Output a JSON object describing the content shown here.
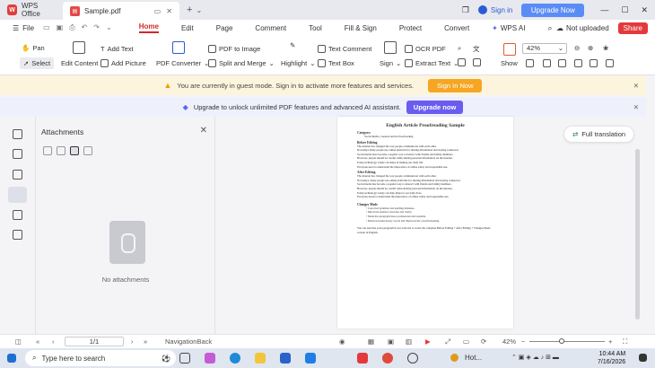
{
  "titlebar": {
    "app_tab": "WPS Office",
    "doc_tab": "Sample.pdf",
    "signin": "Sign in",
    "upgrade": "Upgrade Now"
  },
  "menubar": {
    "file": "File",
    "items": [
      "Home",
      "Edit",
      "Page",
      "Comment",
      "Tool",
      "Fill & Sign",
      "Protect",
      "Convert"
    ],
    "wps_ai": "WPS AI",
    "not_uploaded": "Not uploaded",
    "share": "Share"
  },
  "ribbon": {
    "pan": "Pan",
    "select": "Select",
    "edit_content": "Edit Content",
    "add_text": "Add Text",
    "add_picture": "Add Picture",
    "pdf_converter": "PDF Converter",
    "pdf_to_image": "PDF to Image",
    "split_merge": "Split and Merge",
    "highlight": "Highlight",
    "text_comment": "Text Comment",
    "text_box": "Text Box",
    "sign": "Sign",
    "ocr_pdf": "OCR PDF",
    "extract_text": "Extract Text",
    "show": "Show",
    "zoom": "42%"
  },
  "banners": {
    "guest": "You are currently in guest mode. Sign in to activate more features and services.",
    "sign_in_now": "Sign In Now",
    "upgrade": "Upgrade to unlock unlimited PDF features and advanced AI assistant.",
    "upgrade_now": "Upgrade now"
  },
  "attachments": {
    "title": "Attachments",
    "empty": "No attachments"
  },
  "document": {
    "title": "English Article Proofreading Sample",
    "category_label": "Category:",
    "category": "Social Media | General Article Proofreading",
    "before": "Before Editing",
    "before_lines": [
      "The internet has changed the way people communicate with each other.",
      "Nowadays many people use online platform for sharing information and staying connected.",
      "Social media have become a popular way to interact with friends and family members.",
      "However, people should be careful while sharing personal information on the internet.",
      "Using technology wisely can helps in making our daily life.",
      "Everyone need to understand the importance of online safety and responsible use."
    ],
    "after": "After Editing",
    "after_lines": [
      "The internet has changed the way people communicate with each other.",
      "Nowadays, many people use online platforms for sharing information and staying connected.",
      "Social media has become a popular way to interact with friends and family members.",
      "However, people should be careful when sharing personal information on the internet.",
      "Using technology wisely can help improve our daily lives.",
      "Everyone needs to understand the importance of online safety and responsible use."
    ],
    "changes": "Changes Made",
    "change_items": [
      "Corrected grammar and spelling mistakes.",
      "Improved sentence structure and clarity.",
      "Made the paragraph more professional and readable.",
      "Removed unnecessary words and improved the overall meaning."
    ],
    "closing": "You can send me your paragraph if you want me to create the complete Before Editing + After Editing + Changes Made version in English."
  },
  "full_translation": "Full translation",
  "statusbar": {
    "page": "1/1",
    "nav": "NavigationBack",
    "zoom": "42%"
  },
  "taskbar": {
    "search_placeholder": "Type here to search",
    "hot": "Hot...",
    "time": "10:44 AM",
    "date": "7/16/2026"
  }
}
